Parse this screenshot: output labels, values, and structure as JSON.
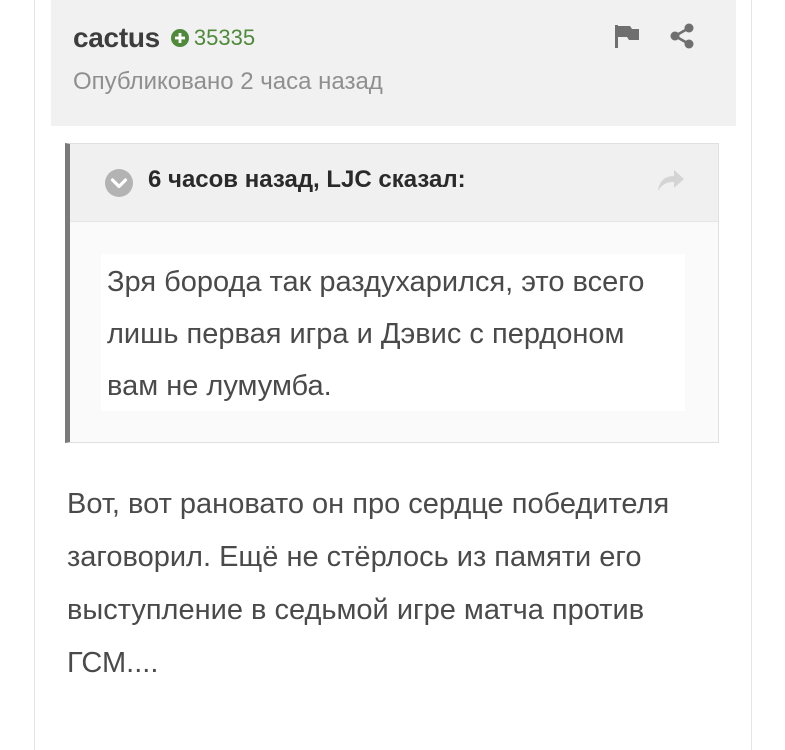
{
  "post": {
    "author": "cactus",
    "reputation": "35335",
    "published": "Опубликовано 2 часа назад",
    "body": "Вот, вот рановато он про сердце победителя заговорил. Ещё не стёрлось из памяти его  выступление в седьмой игре матча против ГСМ....",
    "actions": {
      "report_icon": "flag-icon",
      "share_icon": "share-icon"
    }
  },
  "quote": {
    "citation": "6 часов назад, LJC сказал:",
    "text": "Зря борода так раздухарился, это всего лишь первая игра и Дэвис с пердоном вам не лумумба.",
    "icons": {
      "toggle": "chevron-down-icon",
      "goto": "arrow-share-icon"
    }
  },
  "colors": {
    "reputation_positive": "#4e8a3a",
    "header_bg": "#f1f1f1",
    "quote_border": "#7a7a7a"
  }
}
